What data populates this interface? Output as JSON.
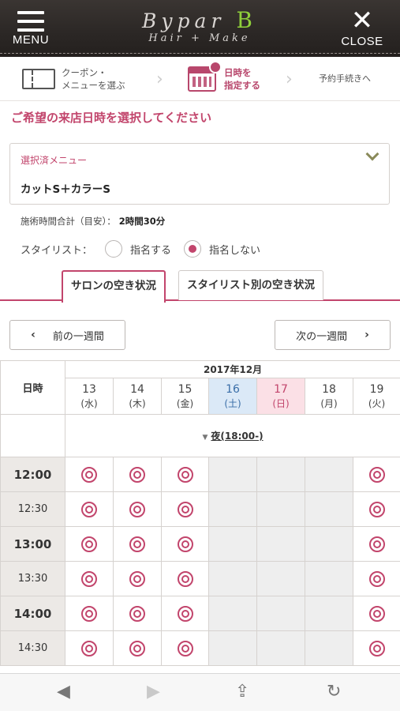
{
  "header": {
    "menu_label": "MENU",
    "close_label": "CLOSE",
    "logo_main": "Bypar",
    "logo_mark": "B",
    "logo_sub": "Hair + Make"
  },
  "steps": [
    {
      "line1": "クーポン・",
      "line2": "メニューを選ぶ"
    },
    {
      "line1": "日時を",
      "line2": "指定する"
    },
    {
      "line1": "予約手続きへ",
      "line2": ""
    }
  ],
  "page_title": "ご希望の来店日時を選択してください",
  "selected_menu": {
    "label": "選択済メニュー",
    "value": "カットS＋カラーS"
  },
  "duration": {
    "label": "施術時間合計（目安）：",
    "value": "2時間30分"
  },
  "stylist": {
    "label": "スタイリスト：",
    "options": [
      {
        "label": "指名する",
        "selected": false
      },
      {
        "label": "指名しない",
        "selected": true
      }
    ]
  },
  "tabs": [
    {
      "label": "サロンの空き状況",
      "active": true
    },
    {
      "label": "スタイリスト別の空き状況",
      "active": false
    }
  ],
  "week_nav": {
    "prev": "前の一週間",
    "next": "次の一週間",
    "prev_arrow": "‹",
    "next_arrow": "›"
  },
  "calendar": {
    "corner_label": "日時",
    "month": "2017年12月",
    "days": [
      {
        "num": "13",
        "wd": "(水)",
        "type": "weekday"
      },
      {
        "num": "14",
        "wd": "(木)",
        "type": "weekday"
      },
      {
        "num": "15",
        "wd": "(金)",
        "type": "weekday"
      },
      {
        "num": "16",
        "wd": "(土)",
        "type": "sat"
      },
      {
        "num": "17",
        "wd": "(日)",
        "type": "sun"
      },
      {
        "num": "18",
        "wd": "(月)",
        "type": "weekday"
      },
      {
        "num": "19",
        "wd": "(火)",
        "type": "weekday"
      }
    ],
    "evening_link": "夜(18:00-)",
    "slots": [
      {
        "time": "12:00",
        "major": true,
        "avail": [
          true,
          true,
          true,
          false,
          false,
          false,
          true
        ]
      },
      {
        "time": "12:30",
        "major": false,
        "avail": [
          true,
          true,
          true,
          false,
          false,
          false,
          true
        ]
      },
      {
        "time": "13:00",
        "major": true,
        "avail": [
          true,
          true,
          true,
          false,
          false,
          false,
          true
        ]
      },
      {
        "time": "13:30",
        "major": false,
        "avail": [
          true,
          true,
          true,
          false,
          false,
          false,
          true
        ]
      },
      {
        "time": "14:00",
        "major": true,
        "avail": [
          true,
          true,
          true,
          false,
          false,
          false,
          true
        ]
      },
      {
        "time": "14:30",
        "major": false,
        "avail": [
          true,
          true,
          true,
          false,
          false,
          false,
          true
        ]
      }
    ]
  },
  "colors": {
    "accent": "#c2456c",
    "saturday_bg": "#dbe9f7",
    "sunday_bg": "#fbe0e6",
    "header_bg": "#2b2725"
  },
  "browser_bar": {
    "back": "◀",
    "forward": "▶",
    "share": "⇪",
    "reload": "↻"
  }
}
